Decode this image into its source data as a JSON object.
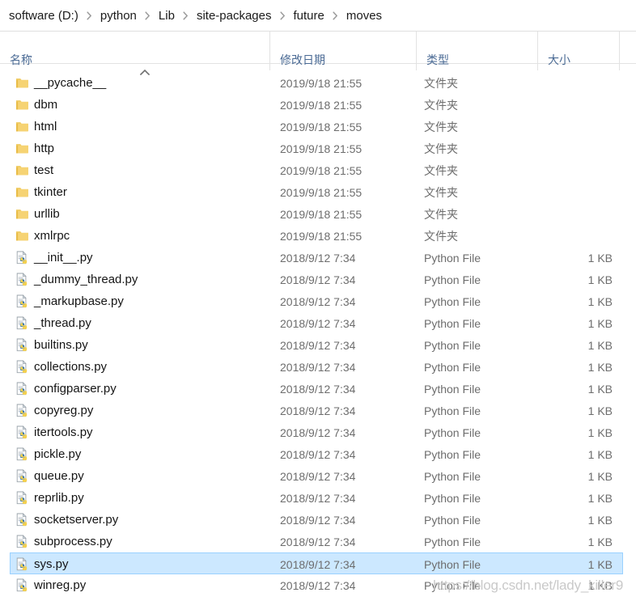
{
  "breadcrumb": {
    "separator_icon": "chevron-right-icon",
    "items": [
      {
        "label": "software (D:)"
      },
      {
        "label": "python"
      },
      {
        "label": "Lib"
      },
      {
        "label": "site-packages"
      },
      {
        "label": "future"
      },
      {
        "label": "moves"
      }
    ]
  },
  "columns": {
    "sort_icon": "sort-ascending-caret-icon",
    "headers": [
      {
        "label": "名称",
        "key": "name"
      },
      {
        "label": "修改日期",
        "key": "date"
      },
      {
        "label": "类型",
        "key": "type"
      },
      {
        "label": "大小",
        "key": "size"
      }
    ]
  },
  "colors": {
    "selection_fill": "#cce8ff",
    "selection_border": "#99d1ff",
    "header_text": "#4a6a94",
    "folder_icon": "#f6d373",
    "python_icon_blue": "#3c78aa",
    "python_icon_yellow": "#f5d14e",
    "watermark": "#c9c9c9"
  },
  "rows": [
    {
      "name": "__pycache__",
      "icon": "folder-icon",
      "date": "2019/9/18 21:55",
      "type": "文件夹",
      "size": "",
      "selected": false
    },
    {
      "name": "dbm",
      "icon": "folder-icon",
      "date": "2019/9/18 21:55",
      "type": "文件夹",
      "size": "",
      "selected": false
    },
    {
      "name": "html",
      "icon": "folder-icon",
      "date": "2019/9/18 21:55",
      "type": "文件夹",
      "size": "",
      "selected": false
    },
    {
      "name": "http",
      "icon": "folder-icon",
      "date": "2019/9/18 21:55",
      "type": "文件夹",
      "size": "",
      "selected": false
    },
    {
      "name": "test",
      "icon": "folder-icon",
      "date": "2019/9/18 21:55",
      "type": "文件夹",
      "size": "",
      "selected": false
    },
    {
      "name": "tkinter",
      "icon": "folder-icon",
      "date": "2019/9/18 21:55",
      "type": "文件夹",
      "size": "",
      "selected": false
    },
    {
      "name": "urllib",
      "icon": "folder-icon",
      "date": "2019/9/18 21:55",
      "type": "文件夹",
      "size": "",
      "selected": false
    },
    {
      "name": "xmlrpc",
      "icon": "folder-icon",
      "date": "2019/9/18 21:55",
      "type": "文件夹",
      "size": "",
      "selected": false
    },
    {
      "name": "__init__.py",
      "icon": "python-file-icon",
      "date": "2018/9/12 7:34",
      "type": "Python File",
      "size": "1 KB",
      "selected": false
    },
    {
      "name": "_dummy_thread.py",
      "icon": "python-file-icon",
      "date": "2018/9/12 7:34",
      "type": "Python File",
      "size": "1 KB",
      "selected": false
    },
    {
      "name": "_markupbase.py",
      "icon": "python-file-icon",
      "date": "2018/9/12 7:34",
      "type": "Python File",
      "size": "1 KB",
      "selected": false
    },
    {
      "name": "_thread.py",
      "icon": "python-file-icon",
      "date": "2018/9/12 7:34",
      "type": "Python File",
      "size": "1 KB",
      "selected": false
    },
    {
      "name": "builtins.py",
      "icon": "python-file-icon",
      "date": "2018/9/12 7:34",
      "type": "Python File",
      "size": "1 KB",
      "selected": false
    },
    {
      "name": "collections.py",
      "icon": "python-file-icon",
      "date": "2018/9/12 7:34",
      "type": "Python File",
      "size": "1 KB",
      "selected": false
    },
    {
      "name": "configparser.py",
      "icon": "python-file-icon",
      "date": "2018/9/12 7:34",
      "type": "Python File",
      "size": "1 KB",
      "selected": false
    },
    {
      "name": "copyreg.py",
      "icon": "python-file-icon",
      "date": "2018/9/12 7:34",
      "type": "Python File",
      "size": "1 KB",
      "selected": false
    },
    {
      "name": "itertools.py",
      "icon": "python-file-icon",
      "date": "2018/9/12 7:34",
      "type": "Python File",
      "size": "1 KB",
      "selected": false
    },
    {
      "name": "pickle.py",
      "icon": "python-file-icon",
      "date": "2018/9/12 7:34",
      "type": "Python File",
      "size": "1 KB",
      "selected": false
    },
    {
      "name": "queue.py",
      "icon": "python-file-icon",
      "date": "2018/9/12 7:34",
      "type": "Python File",
      "size": "1 KB",
      "selected": false
    },
    {
      "name": "reprlib.py",
      "icon": "python-file-icon",
      "date": "2018/9/12 7:34",
      "type": "Python File",
      "size": "1 KB",
      "selected": false
    },
    {
      "name": "socketserver.py",
      "icon": "python-file-icon",
      "date": "2018/9/12 7:34",
      "type": "Python File",
      "size": "1 KB",
      "selected": false
    },
    {
      "name": "subprocess.py",
      "icon": "python-file-icon",
      "date": "2018/9/12 7:34",
      "type": "Python File",
      "size": "1 KB",
      "selected": false
    },
    {
      "name": "sys.py",
      "icon": "python-file-icon",
      "date": "2018/9/12 7:34",
      "type": "Python File",
      "size": "1 KB",
      "selected": true
    },
    {
      "name": "winreg.py",
      "icon": "python-file-icon",
      "date": "2018/9/12 7:34",
      "type": "Python File",
      "size": "1 KB",
      "selected": false
    }
  ],
  "watermark": {
    "text": "https://blog.csdn.net/lady_killer9"
  }
}
